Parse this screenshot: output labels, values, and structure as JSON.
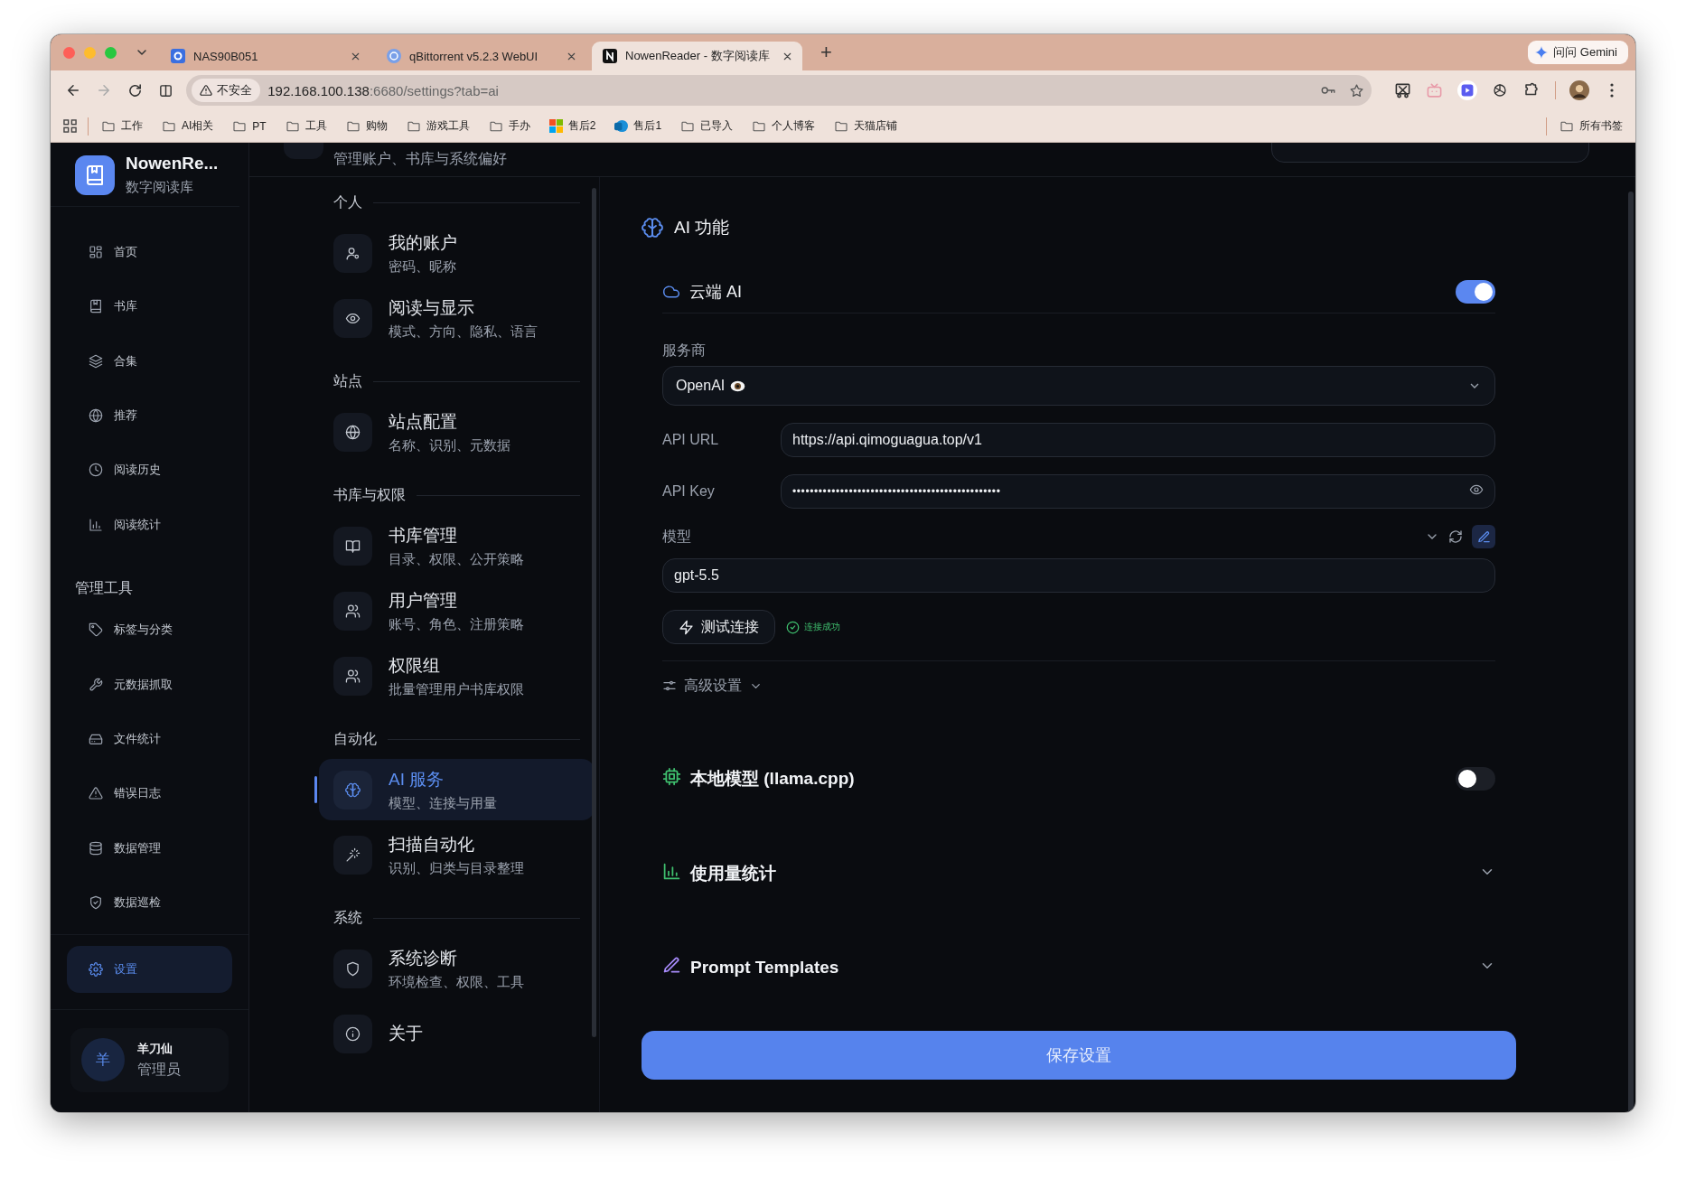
{
  "browser": {
    "tabs": [
      {
        "title": "NAS90B051",
        "selected": false
      },
      {
        "title": "qBittorrent v5.2.3 WebUI",
        "selected": false
      },
      {
        "title": "NowenReader - 数字阅读库",
        "selected": true
      }
    ],
    "new_tab": "+",
    "gemini": "问问 Gemini",
    "security": "不安全",
    "url_host": "192.168.100.138",
    "url_path": ":6680/settings?tab=ai",
    "bookmarks": [
      {
        "label": "工作",
        "kind": "folder"
      },
      {
        "label": "AI相关",
        "kind": "folder"
      },
      {
        "label": "PT",
        "kind": "folder"
      },
      {
        "label": "工具",
        "kind": "folder"
      },
      {
        "label": "购物",
        "kind": "folder"
      },
      {
        "label": "游戏工具",
        "kind": "folder"
      },
      {
        "label": "手办",
        "kind": "folder"
      },
      {
        "label": "售后2",
        "kind": "tiles"
      },
      {
        "label": "售后1",
        "kind": "app"
      },
      {
        "label": "已导入",
        "kind": "folder"
      },
      {
        "label": "个人博客",
        "kind": "folder"
      },
      {
        "label": "天猫店铺",
        "kind": "folder"
      }
    ],
    "all_bookmarks": "所有书签"
  },
  "sidebar": {
    "brand": {
      "name": "NowenRe...",
      "subtitle": "数字阅读库"
    },
    "groups": [
      {
        "items": [
          {
            "label": "首页",
            "selected": false
          },
          {
            "label": "书库",
            "selected": false
          },
          {
            "label": "合集",
            "selected": false
          },
          {
            "label": "推荐",
            "selected": false
          },
          {
            "label": "阅读历史",
            "selected": false
          },
          {
            "label": "阅读统计",
            "selected": false
          }
        ]
      },
      {
        "heading": "管理工具",
        "items": [
          {
            "label": "标签与分类",
            "selected": false
          },
          {
            "label": "元数据抓取",
            "selected": false
          },
          {
            "label": "文件统计",
            "selected": false
          },
          {
            "label": "错误日志",
            "selected": false
          },
          {
            "label": "数据管理",
            "selected": false
          },
          {
            "label": "数据巡检",
            "selected": false
          }
        ]
      },
      {
        "items": [
          {
            "label": "设置",
            "selected": true
          }
        ]
      }
    ],
    "user": {
      "avatar": "羊",
      "name": "羊刀仙",
      "role": "管理员"
    }
  },
  "settings_nav": {
    "subtitle": "管理账户、书库与系统偏好",
    "groups": [
      {
        "title": "个人",
        "items": [
          {
            "title": "我的账户",
            "subtitle": "密码、昵称",
            "selected": false
          },
          {
            "title": "阅读与显示",
            "subtitle": "模式、方向、隐私、语言",
            "selected": false
          }
        ]
      },
      {
        "title": "站点",
        "items": [
          {
            "title": "站点配置",
            "subtitle": "名称、识别、元数据",
            "selected": false
          }
        ]
      },
      {
        "title": "书库与权限",
        "items": [
          {
            "title": "书库管理",
            "subtitle": "目录、权限、公开策略",
            "selected": false
          },
          {
            "title": "用户管理",
            "subtitle": "账号、角色、注册策略",
            "selected": false
          },
          {
            "title": "权限组",
            "subtitle": "批量管理用户书库权限",
            "selected": false
          }
        ]
      },
      {
        "title": "自动化",
        "items": [
          {
            "title": "AI 服务",
            "subtitle": "模型、连接与用量",
            "selected": true
          },
          {
            "title": "扫描自动化",
            "subtitle": "识别、归类与目录整理",
            "selected": false
          }
        ]
      },
      {
        "title": "系统",
        "items": [
          {
            "title": "系统诊断",
            "subtitle": "环境检查、权限、工具",
            "selected": false
          },
          {
            "title": "关于",
            "selected": false
          }
        ]
      }
    ]
  },
  "panel": {
    "title": "AI 功能",
    "cloud": {
      "title": "云端 AI",
      "on": true,
      "provider": {
        "label": "服务商",
        "value": "OpenAI"
      },
      "api_url": {
        "label": "API URL",
        "value": "https://api.qimoguagua.top/v1"
      },
      "api_key": {
        "label": "API Key",
        "value": "••••••••••••••••••••••••••••••••••••••••••••••••"
      },
      "model": {
        "label": "模型",
        "value": "gpt-5.5"
      },
      "test_button": "测试连接",
      "test_status": "连接成功",
      "advanced": {
        "label": "高级设置",
        "expanded": false
      }
    },
    "local": {
      "title": "本地模型 (llama.cpp)",
      "on": false
    },
    "sections": [
      {
        "title": "使用量统计",
        "expanded": false
      },
      {
        "title": "Prompt Templates",
        "expanded": false
      }
    ],
    "save_button": "保存设置"
  }
}
